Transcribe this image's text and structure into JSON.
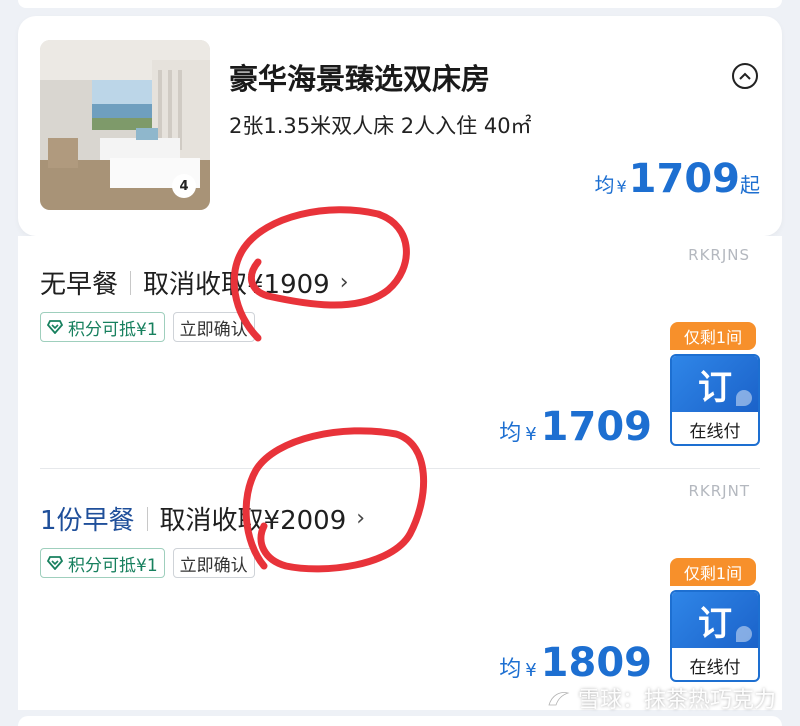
{
  "room": {
    "title": "豪华海景臻选双床房",
    "description": "2张1.35米双人床  2人入住  40㎡",
    "photo_count": "4",
    "price_prefix": "均",
    "currency": "¥",
    "price": "1709",
    "price_suffix": "起"
  },
  "rates": [
    {
      "code": "RKRJNS",
      "breakfast": "无早餐",
      "cancel_label": "取消收取¥1909",
      "tags": [
        "积分可抵¥1",
        "立即确认"
      ],
      "stock": "仅剩1间",
      "price_prefix": "均",
      "currency": "¥",
      "price": "1709",
      "book_label": "订",
      "pay_label": "在线付"
    },
    {
      "code": "RKRJNT",
      "breakfast": "1份早餐",
      "cancel_label": "取消收取¥2009",
      "tags": [
        "积分可抵¥1",
        "立即确认"
      ],
      "stock": "仅剩1间",
      "price_prefix": "均",
      "currency": "¥",
      "price": "1809",
      "book_label": "订",
      "pay_label": "在线付"
    }
  ],
  "watermark": {
    "text": "雪球：抹茶热巧克力"
  },
  "colors": {
    "price_blue": "#1d6fd1",
    "stock_orange": "#f7902b",
    "tag_green": "#17805e",
    "annotation_red": "#e8333a"
  }
}
